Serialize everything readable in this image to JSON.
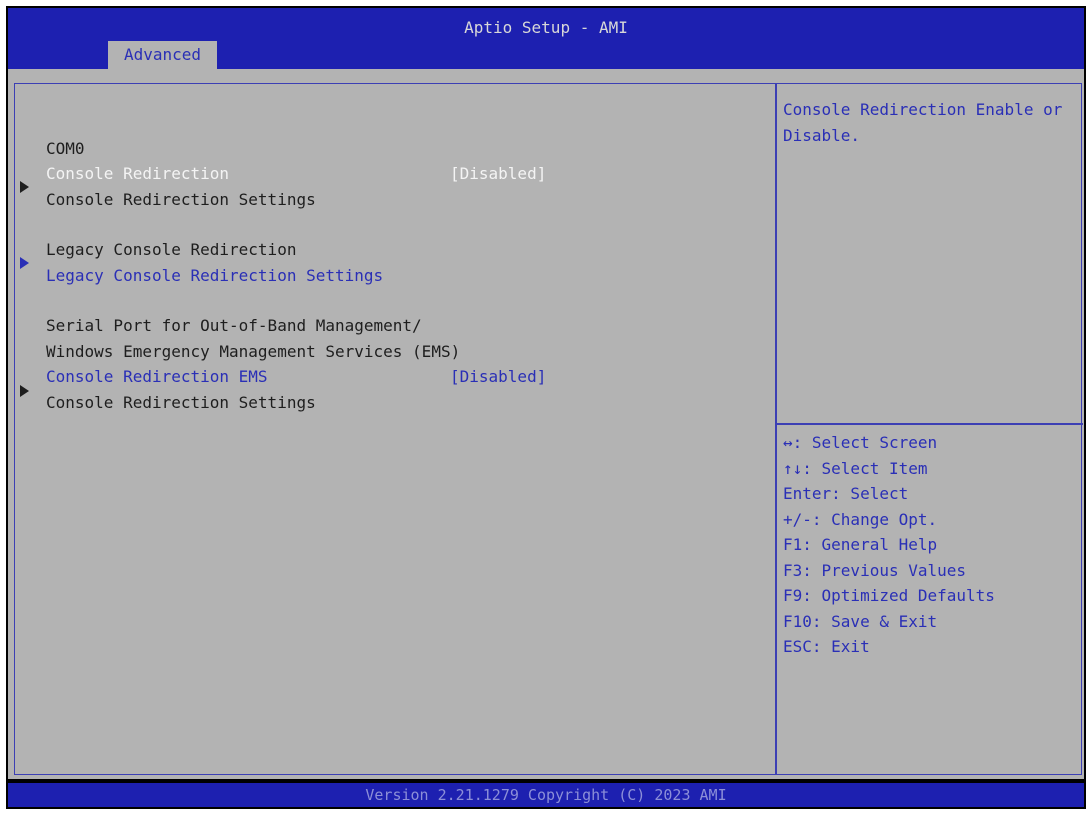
{
  "header": {
    "title": "Aptio Setup - AMI",
    "active_tab": "Advanced"
  },
  "items": {
    "com0_heading": "COM0",
    "console_redirection": {
      "label": "Console Redirection",
      "value": "[Disabled]"
    },
    "console_redirection_settings": "Console Redirection Settings",
    "legacy_heading": "Legacy Console Redirection",
    "legacy_settings": "Legacy Console Redirection Settings",
    "serial_heading_1": "Serial Port for Out-of-Band Management/",
    "serial_heading_2": "Windows Emergency Management Services (EMS)",
    "console_redirection_ems": {
      "label": "Console Redirection EMS",
      "value": "[Disabled]"
    },
    "ems_settings": "Console Redirection Settings"
  },
  "help": {
    "description": "Console Redirection Enable or Disable."
  },
  "keys": [
    "↔: Select Screen",
    "↑↓: Select Item",
    "Enter: Select",
    "+/-: Change Opt.",
    "F1: General Help",
    "F3: Previous Values",
    "F9: Optimized Defaults",
    "F10: Save & Exit",
    "ESC: Exit"
  ],
  "footer": {
    "text": "Version 2.21.1279 Copyright (C) 2023 AMI"
  },
  "colors": {
    "header_bg": "#1d20b0",
    "panel_bg": "#b3b3b3",
    "accent_text": "#2a2fb6",
    "highlight_text": "#f4f4f4"
  }
}
